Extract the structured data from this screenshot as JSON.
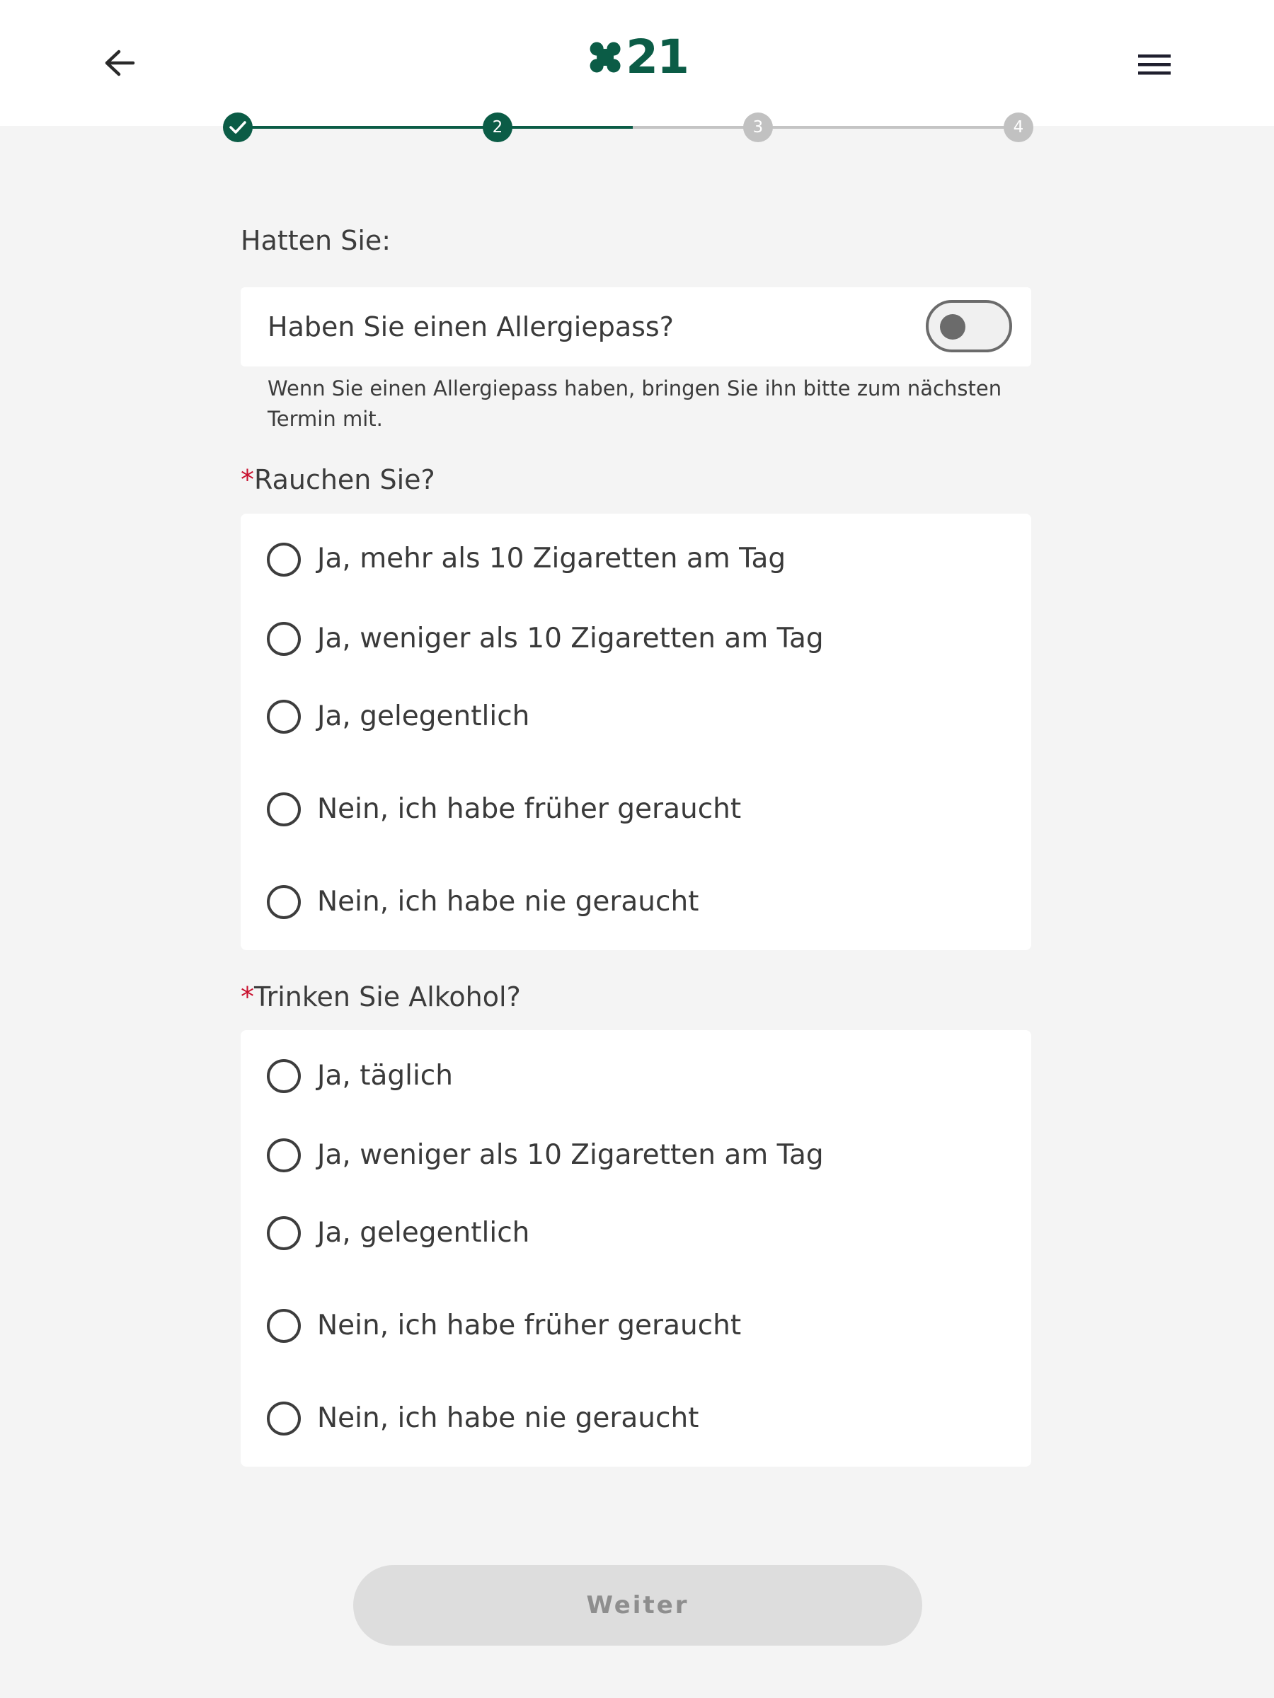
{
  "header": {
    "back_icon": "arrow-left-icon",
    "menu_icon": "hamburger-menu-icon",
    "logo_text": "21",
    "logo_color": "#0b5c46"
  },
  "stepper": {
    "steps": [
      {
        "label": "",
        "state": "done",
        "icon": "check-icon"
      },
      {
        "label": "2",
        "state": "active"
      },
      {
        "label": "3",
        "state": "todo"
      },
      {
        "label": "4",
        "state": "todo"
      }
    ],
    "current_step": 2
  },
  "intro_label": "Hatten Sie:",
  "allergy": {
    "label": "Haben Sie einen Allergiepass?",
    "toggle_on": false,
    "helper": "Wenn Sie einen Allergiepass haben, bringen Sie ihn bitte zum nächsten Termin mit."
  },
  "smoking": {
    "required_mark": "*",
    "question": "Rauchen Sie?",
    "options": [
      "Ja, mehr als 10 Zigaretten am Tag",
      "Ja, weniger als 10 Zigaretten am Tag",
      "Ja, gelegentlich",
      "Nein, ich habe früher geraucht",
      "Nein, ich habe nie geraucht"
    ]
  },
  "alcohol": {
    "required_mark": "*",
    "question": "Trinken Sie Alkohol?",
    "options": [
      "Ja, täglich",
      "Ja, weniger als 10 Zigaretten am Tag",
      "Ja, gelegentlich",
      "Nein, ich habe früher geraucht",
      "Nein, ich habe nie geraucht"
    ]
  },
  "footer": {
    "next_label": "Weiter",
    "next_enabled": false
  },
  "colors": {
    "brand_green": "#0b5c46",
    "required_red": "#c8102e",
    "background": "#f4f4f4",
    "disabled_button": "#dddddd"
  }
}
